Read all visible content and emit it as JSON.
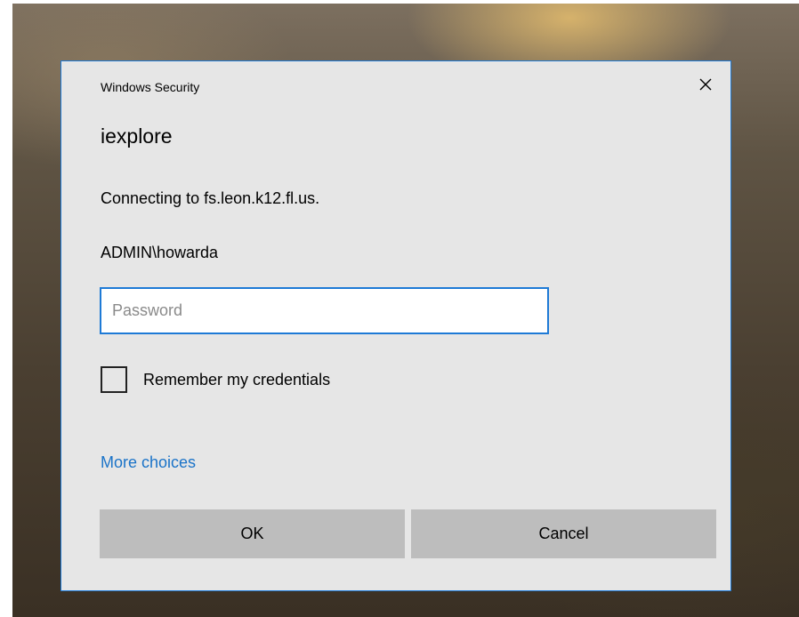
{
  "dialog": {
    "caption": "Windows Security",
    "close_glyph": "✕",
    "app_title": "iexplore",
    "connecting_text": "Connecting to fs.leon.k12.fl.us.",
    "username": "ADMIN\\howarda",
    "password": {
      "placeholder": "Password",
      "value": ""
    },
    "remember_label": "Remember my credentials",
    "remember_checked": false,
    "more_choices": "More choices",
    "ok_label": "OK",
    "cancel_label": "Cancel"
  },
  "colors": {
    "accent": "#1e7ad6",
    "link": "#1a73c8",
    "dialog_bg": "#e6e6e6",
    "button_bg": "#bdbdbd"
  },
  "icons": {
    "close": "close-icon"
  }
}
